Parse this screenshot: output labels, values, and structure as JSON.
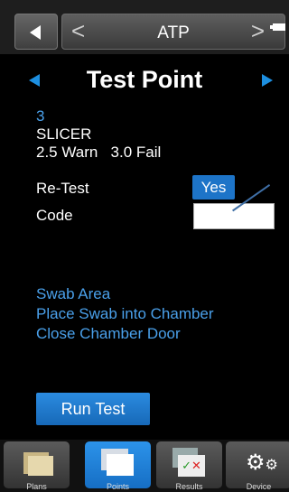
{
  "header": {
    "nav_title": "ATP",
    "prev_glyph": "<",
    "next_glyph": ">"
  },
  "page": {
    "title": "Test Point"
  },
  "point": {
    "number": "3",
    "name": "SLICER",
    "limits": "2.5 Warn   3.0 Fail"
  },
  "form": {
    "retest_label": "Re-Test",
    "retest_value": "Yes",
    "code_label": "Code",
    "code_value": ""
  },
  "instructions": [
    "Swab Area",
    "Place Swab into Chamber",
    "Close Chamber Door"
  ],
  "run_button_label": "Run Test",
  "tabs": [
    {
      "label": "Plans",
      "icon": "folder-icon"
    },
    {
      "label": "Points",
      "icon": "pages-icon",
      "active": true
    },
    {
      "label": "Results",
      "icon": "results-icon"
    },
    {
      "label": "Device",
      "icon": "gears-icon"
    }
  ],
  "colors": {
    "accent": "#1d74c8",
    "info_text": "#4aa0ea",
    "background": "#000000"
  }
}
